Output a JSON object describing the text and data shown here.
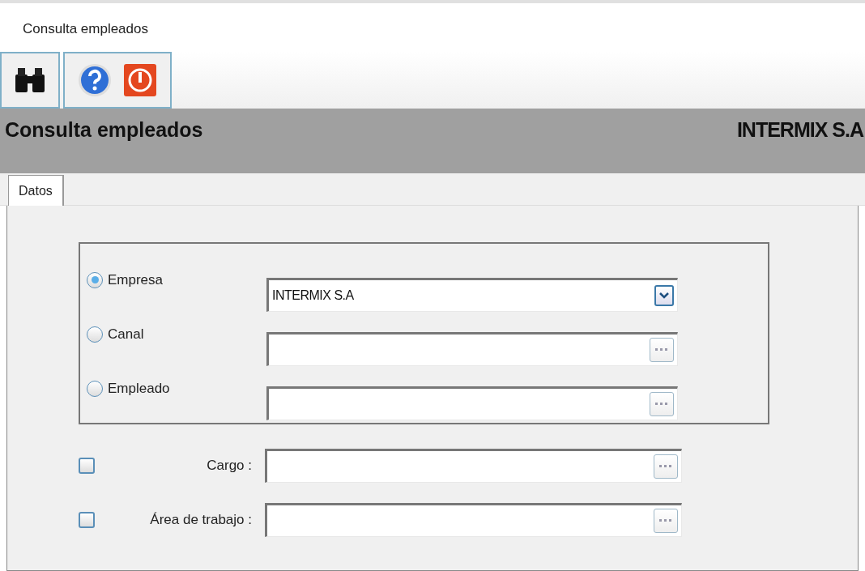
{
  "window": {
    "title": "Consulta empleados"
  },
  "header": {
    "title": "Consulta empleados",
    "company": "INTERMIX S.A"
  },
  "tabs": [
    {
      "label": "Datos",
      "selected": true
    }
  ],
  "options": [
    {
      "label": "Empresa",
      "selected": true,
      "kind": "dropdown",
      "value": "INTERMIX S.A"
    },
    {
      "label": "Canal",
      "selected": false,
      "kind": "lookup"
    },
    {
      "label": "Empleado",
      "selected": false,
      "kind": "lookup"
    }
  ],
  "filters": [
    {
      "label": "Cargo :",
      "checked": false
    },
    {
      "label": "Área de trabajo :",
      "checked": false
    }
  ]
}
